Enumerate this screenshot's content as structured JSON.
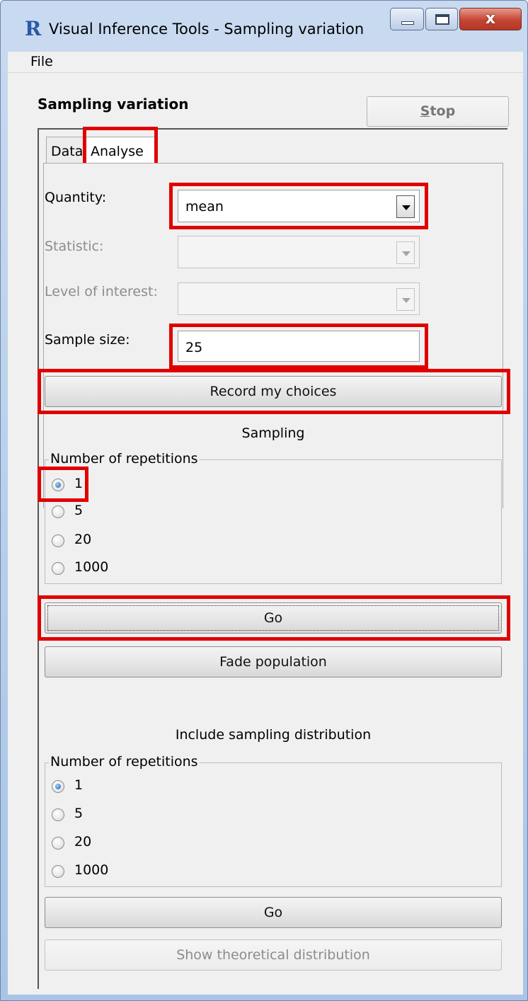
{
  "window": {
    "title": "Visual Inference Tools - Sampling variation",
    "close_glyph": "x"
  },
  "menu": {
    "file": "File"
  },
  "header": {
    "title": "Sampling variation",
    "stop_prefix": "S",
    "stop_rest": "top"
  },
  "tabs": [
    {
      "label": "Data"
    },
    {
      "label": "Analyse"
    }
  ],
  "form": {
    "quantity_label": "Quantity:",
    "quantity_value": "mean",
    "statistic_label": "Statistic:",
    "statistic_value": "",
    "level_label": "Level of interest:",
    "level_value": "",
    "sample_size_label": "Sample size:",
    "sample_size_value": "25",
    "record_button": "Record my choices"
  },
  "sampling": {
    "heading": "Sampling",
    "group_label": "Number of repetitions",
    "options": [
      "1",
      "5",
      "20",
      "1000"
    ],
    "selected": "1",
    "go_button": "Go",
    "fade_button": "Fade population"
  },
  "distribution": {
    "heading": "Include sampling distribution",
    "group_label": "Number of repetitions",
    "options": [
      "1",
      "5",
      "20",
      "1000"
    ],
    "selected": "1",
    "go_button": "Go",
    "theoretical_button": "Show theoretical distribution"
  },
  "colors": {
    "highlight": "#e00000",
    "window_frame": "#a9c4e6",
    "close_button": "#c64432"
  },
  "icons": [
    "r-logo-icon",
    "minimize-icon",
    "maximize-icon",
    "close-icon",
    "dropdown-arrow-icon",
    "radio-icon"
  ]
}
